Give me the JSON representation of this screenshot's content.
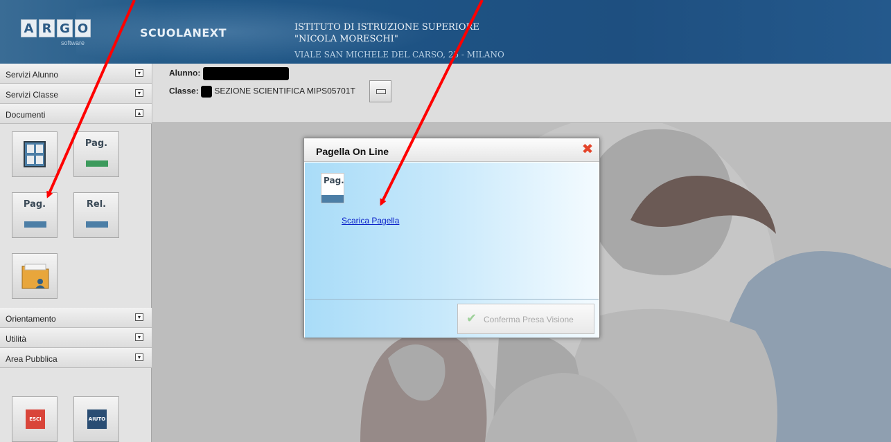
{
  "header": {
    "logo_letters": [
      "A",
      "R",
      "G",
      "O"
    ],
    "logo_sub": "software",
    "brand": "SCUOLANEXT",
    "school_line1": "ISTITUTO DI ISTRUZIONE SUPERIORE",
    "school_line2": "\"NICOLA MORESCHI\"",
    "address": "VIALE SAN MICHELE DEL CARSO, 25 - MILANO"
  },
  "sidebar": {
    "menu": [
      {
        "label": "Servizi Alunno",
        "toggle": "▾"
      },
      {
        "label": "Servizi Classe",
        "toggle": "▾"
      },
      {
        "label": "Documenti",
        "toggle": "▴"
      },
      {
        "label": "Orientamento",
        "toggle": "▾"
      },
      {
        "label": "Utilità",
        "toggle": "▾"
      },
      {
        "label": "Area Pubblica",
        "toggle": "▾"
      }
    ],
    "tiles": {
      "tile2": "Pag.",
      "tile3": "Pag.",
      "tile4": "Rel."
    },
    "exit_label": "ESCI",
    "help_label": "AIUTO"
  },
  "info": {
    "student_label": "Alunno:",
    "class_label": "Classe:",
    "class_value": "SEZIONE SCIENTIFICA MIPS05701T"
  },
  "dialog": {
    "title": "Pagella On Line",
    "icon_label": "Pag.",
    "link_text": "Scarica Pagella",
    "confirm_label": "Conferma Presa Visione"
  },
  "colors": {
    "header_blue": "#1e5384",
    "accent_red": "#e4452b",
    "link_blue": "#0c22c9",
    "green_bar": "#3c9a5c",
    "blue_bar": "#4c7ea6"
  }
}
